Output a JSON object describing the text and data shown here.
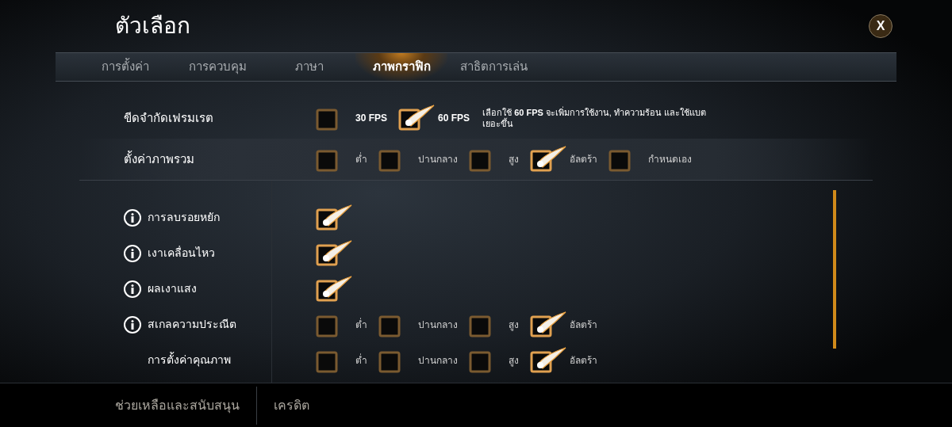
{
  "title": "ตัวเลือก",
  "close_button": "X",
  "tabs": [
    {
      "label": "การตั้งค่า",
      "selected": false
    },
    {
      "label": "การควบคุม",
      "selected": false
    },
    {
      "label": "ภาษา",
      "selected": false
    },
    {
      "label": "ภาพกราฟิก",
      "selected": true
    },
    {
      "label": "สาธิตการเล่น",
      "selected": false
    }
  ],
  "top_settings": [
    {
      "label": "ขีดจำกัดเฟรมเรต",
      "options": [
        {
          "label": "30 FPS",
          "selected": false
        },
        {
          "label": "60 FPS",
          "selected": true
        }
      ],
      "note": "เลือกใช้ **60 FPS** จะเพิ่มการใช้งาน, ทำความร้อน และใช้แบตเยอะขึ้น"
    },
    {
      "label": "ตั้งค่าภาพรวม",
      "options": [
        {
          "label": "ต่ำ",
          "selected": false
        },
        {
          "label": "ปานกลาง",
          "selected": false
        },
        {
          "label": "สูง",
          "selected": false
        },
        {
          "label": "อัลตร้า",
          "selected": true
        },
        {
          "label": "กำหนดเอง",
          "selected": false
        }
      ]
    }
  ],
  "graphics_settings": [
    {
      "label": "การลบรอยหยัก",
      "info": true,
      "kind": "toggle",
      "checked": true
    },
    {
      "label": "เงาเคลื่อนไหว",
      "info": true,
      "kind": "toggle",
      "checked": true
    },
    {
      "label": "ผลเงาแสง",
      "info": true,
      "kind": "toggle",
      "checked": true
    },
    {
      "label": "สเกลความประณีต",
      "info": true,
      "kind": "choice",
      "options": [
        {
          "label": "ต่ำ",
          "selected": false
        },
        {
          "label": "ปานกลาง",
          "selected": false
        },
        {
          "label": "สูง",
          "selected": false
        },
        {
          "label": "อัลตร้า",
          "selected": true
        }
      ]
    },
    {
      "label": "การตั้งค่าคุณภาพ",
      "info": false,
      "kind": "choice",
      "options": [
        {
          "label": "ต่ำ",
          "selected": false
        },
        {
          "label": "ปานกลาง",
          "selected": false
        },
        {
          "label": "สูง",
          "selected": false
        },
        {
          "label": "อัลตร้า",
          "selected": true
        }
      ]
    }
  ],
  "footer_links": [
    "ช่วยเหลือและสนับสนุน",
    "เครดิต"
  ]
}
